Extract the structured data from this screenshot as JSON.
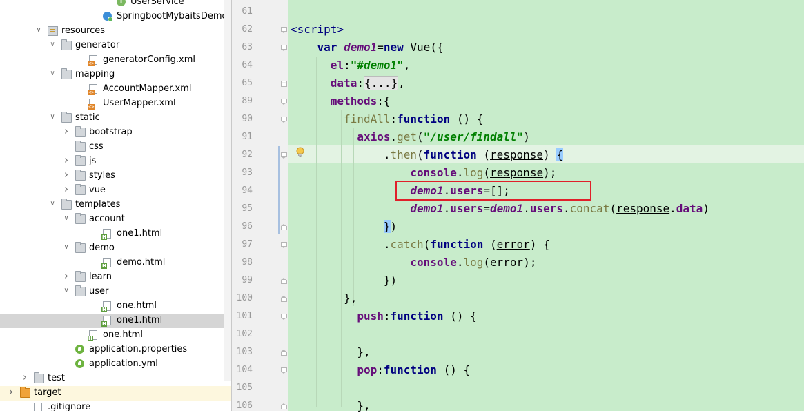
{
  "project_tree": {
    "rows": [
      {
        "label": "UserService",
        "icon": "interface-icon",
        "indent": 170
      },
      {
        "label": "SpringbootMybaitsDemoApp",
        "icon": "spring-class-icon",
        "indent": 150
      },
      {
        "label": "resources",
        "icon": "resources-folder-icon",
        "indent": 70,
        "arrow": "down"
      },
      {
        "label": "generator",
        "icon": "folder-icon",
        "indent": 90,
        "arrow": "down"
      },
      {
        "label": "generatorConfig.xml",
        "icon": "xml-file-icon",
        "indent": 130
      },
      {
        "label": "mapping",
        "icon": "folder-icon",
        "indent": 90,
        "arrow": "down"
      },
      {
        "label": "AccountMapper.xml",
        "icon": "xml-file-icon",
        "indent": 130
      },
      {
        "label": "UserMapper.xml",
        "icon": "xml-file-icon",
        "indent": 130
      },
      {
        "label": "static",
        "icon": "folder-icon",
        "indent": 90,
        "arrow": "down"
      },
      {
        "label": "bootstrap",
        "icon": "folder-icon",
        "indent": 110,
        "arrow": "right"
      },
      {
        "label": "css",
        "icon": "folder-icon",
        "indent": 110
      },
      {
        "label": "js",
        "icon": "folder-icon",
        "indent": 110,
        "arrow": "right"
      },
      {
        "label": "styles",
        "icon": "folder-icon",
        "indent": 110,
        "arrow": "right"
      },
      {
        "label": "vue",
        "icon": "folder-icon",
        "indent": 110,
        "arrow": "right"
      },
      {
        "label": "templates",
        "icon": "folder-icon",
        "indent": 90,
        "arrow": "down"
      },
      {
        "label": "account",
        "icon": "folder-icon",
        "indent": 110,
        "arrow": "down"
      },
      {
        "label": "one1.html",
        "icon": "html-file-icon",
        "indent": 150
      },
      {
        "label": "demo",
        "icon": "folder-icon",
        "indent": 110,
        "arrow": "down"
      },
      {
        "label": "demo.html",
        "icon": "html-file-icon",
        "indent": 150
      },
      {
        "label": "learn",
        "icon": "folder-icon",
        "indent": 110,
        "arrow": "right"
      },
      {
        "label": "user",
        "icon": "folder-icon",
        "indent": 110,
        "arrow": "down"
      },
      {
        "label": "one.html",
        "icon": "html-file-icon",
        "indent": 150
      },
      {
        "label": "one1.html",
        "icon": "html-file-icon",
        "indent": 150,
        "selected": true
      },
      {
        "label": "one.html",
        "icon": "html-file-icon",
        "indent": 130
      },
      {
        "label": "application.properties",
        "icon": "spring-config-icon",
        "indent": 110
      },
      {
        "label": "application.yml",
        "icon": "spring-config-icon",
        "indent": 110
      },
      {
        "label": "test",
        "icon": "folder-icon",
        "indent": 50,
        "arrow": "right"
      },
      {
        "label": "target",
        "icon": "orange-folder-icon",
        "indent": 30,
        "arrow": "right",
        "highlight": true
      },
      {
        "label": ".gitignore",
        "icon": "git-file-icon",
        "indent": 50
      }
    ]
  },
  "editor": {
    "lines": [
      {
        "n": "61",
        "fold": "",
        "segs": []
      },
      {
        "n": "62",
        "fold": "open",
        "segs": [
          [
            "<",
            "tag"
          ],
          [
            "script",
            "tag"
          ],
          [
            ">",
            "tag"
          ]
        ]
      },
      {
        "n": "63",
        "fold": "open",
        "segs": [
          [
            "    ",
            ""
          ],
          [
            "var ",
            "kw"
          ],
          [
            "demo1",
            "gvar"
          ],
          [
            "=",
            ""
          ],
          [
            "new ",
            "kw"
          ],
          [
            "Vue",
            "kw-plain"
          ],
          [
            "({",
            ""
          ]
        ]
      },
      {
        "n": "64",
        "fold": "",
        "segs": [
          [
            "      ",
            ""
          ],
          [
            "el",
            "prop"
          ],
          [
            ":",
            ""
          ],
          [
            "\"#demo1\"",
            "str"
          ],
          [
            ",",
            ""
          ]
        ]
      },
      {
        "n": "65",
        "fold": "plus",
        "segs": [
          [
            "      ",
            ""
          ],
          [
            "data",
            "prop"
          ],
          [
            ":",
            ""
          ],
          [
            "{...}",
            "folded"
          ],
          [
            ",",
            ""
          ]
        ]
      },
      {
        "n": "89",
        "fold": "open",
        "segs": [
          [
            "      ",
            ""
          ],
          [
            "methods",
            "prop"
          ],
          [
            ":{",
            ""
          ]
        ]
      },
      {
        "n": "90",
        "fold": "open",
        "segs": [
          [
            "        ",
            ""
          ],
          [
            "findAll",
            "fn"
          ],
          [
            ":",
            ""
          ],
          [
            "function",
            "kw"
          ],
          [
            " () {",
            ""
          ]
        ]
      },
      {
        "n": "91",
        "fold": "",
        "segs": [
          [
            "          ",
            ""
          ],
          [
            "axios",
            "prop"
          ],
          [
            ".",
            ""
          ],
          [
            "get",
            "fn"
          ],
          [
            "(",
            ""
          ],
          [
            "\"/user/findall\"",
            "str"
          ],
          [
            ")",
            ""
          ]
        ]
      },
      {
        "n": "92",
        "fold": "open",
        "segs": [
          [
            "              ",
            ""
          ],
          [
            ".",
            ""
          ],
          [
            "then",
            "fn"
          ],
          [
            "(",
            ""
          ],
          [
            "function",
            "kw"
          ],
          [
            " (",
            ""
          ],
          [
            "response",
            "ul"
          ],
          [
            ") ",
            ""
          ],
          [
            "{",
            "bracket"
          ]
        ]
      },
      {
        "n": "93",
        "fold": "",
        "segs": [
          [
            "                  ",
            ""
          ],
          [
            "console",
            "prop"
          ],
          [
            ".",
            ""
          ],
          [
            "log",
            "fn"
          ],
          [
            "(",
            ""
          ],
          [
            "response",
            "ul"
          ],
          [
            ");",
            ""
          ]
        ]
      },
      {
        "n": "94",
        "fold": "",
        "segs": [
          [
            "                  ",
            ""
          ],
          [
            "demo1",
            "gvar"
          ],
          [
            ".",
            ""
          ],
          [
            "users",
            "prop"
          ],
          [
            "=[];",
            ""
          ]
        ]
      },
      {
        "n": "95",
        "fold": "",
        "segs": [
          [
            "                  ",
            ""
          ],
          [
            "demo1",
            "gvar"
          ],
          [
            ".",
            ""
          ],
          [
            "users",
            "prop"
          ],
          [
            "=",
            ""
          ],
          [
            "demo1",
            "gvar"
          ],
          [
            ".",
            ""
          ],
          [
            "users",
            "prop"
          ],
          [
            ".",
            ""
          ],
          [
            "concat",
            "fn"
          ],
          [
            "(",
            ""
          ],
          [
            "response",
            "ul"
          ],
          [
            ".",
            ""
          ],
          [
            "data",
            "prop"
          ],
          [
            ")",
            ""
          ]
        ]
      },
      {
        "n": "96",
        "fold": "close",
        "segs": [
          [
            "              ",
            ""
          ],
          [
            "}",
            "bracket"
          ],
          [
            ")",
            ""
          ]
        ]
      },
      {
        "n": "97",
        "fold": "open",
        "segs": [
          [
            "              ",
            ""
          ],
          [
            ".",
            ""
          ],
          [
            "catch",
            "fn"
          ],
          [
            "(",
            ""
          ],
          [
            "function",
            "kw"
          ],
          [
            " (",
            ""
          ],
          [
            "error",
            "ul"
          ],
          [
            ") {",
            ""
          ]
        ]
      },
      {
        "n": "98",
        "fold": "",
        "segs": [
          [
            "                  ",
            ""
          ],
          [
            "console",
            "prop"
          ],
          [
            ".",
            ""
          ],
          [
            "log",
            "fn"
          ],
          [
            "(",
            ""
          ],
          [
            "error",
            "ul"
          ],
          [
            ");",
            ""
          ]
        ]
      },
      {
        "n": "99",
        "fold": "close",
        "segs": [
          [
            "              ",
            ""
          ],
          [
            "})",
            ""
          ]
        ]
      },
      {
        "n": "100",
        "fold": "close",
        "segs": [
          [
            "        ",
            ""
          ],
          [
            "},",
            ""
          ]
        ]
      },
      {
        "n": "101",
        "fold": "open",
        "segs": [
          [
            "          ",
            ""
          ],
          [
            "push",
            "prop-plain"
          ],
          [
            ":",
            ""
          ],
          [
            "function",
            "kw"
          ],
          [
            " () {",
            ""
          ]
        ]
      },
      {
        "n": "102",
        "fold": "",
        "segs": []
      },
      {
        "n": "103",
        "fold": "close",
        "segs": [
          [
            "          ",
            ""
          ],
          [
            "},",
            ""
          ]
        ]
      },
      {
        "n": "104",
        "fold": "open",
        "segs": [
          [
            "          ",
            ""
          ],
          [
            "pop",
            "prop-plain"
          ],
          [
            ":",
            ""
          ],
          [
            "function",
            "kw"
          ],
          [
            " () {",
            ""
          ]
        ]
      },
      {
        "n": "105",
        "fold": "",
        "segs": []
      },
      {
        "n": "106",
        "fold": "close",
        "segs": [
          [
            "          ",
            ""
          ],
          [
            "},",
            ""
          ]
        ]
      }
    ]
  },
  "colors": {
    "editor_bg": "#c8eccb",
    "caret_line": "#e3f3e3",
    "gutter_bg": "#f0f0f0",
    "highlight_box": "#e0202a",
    "selection": "#d5d5d5"
  }
}
